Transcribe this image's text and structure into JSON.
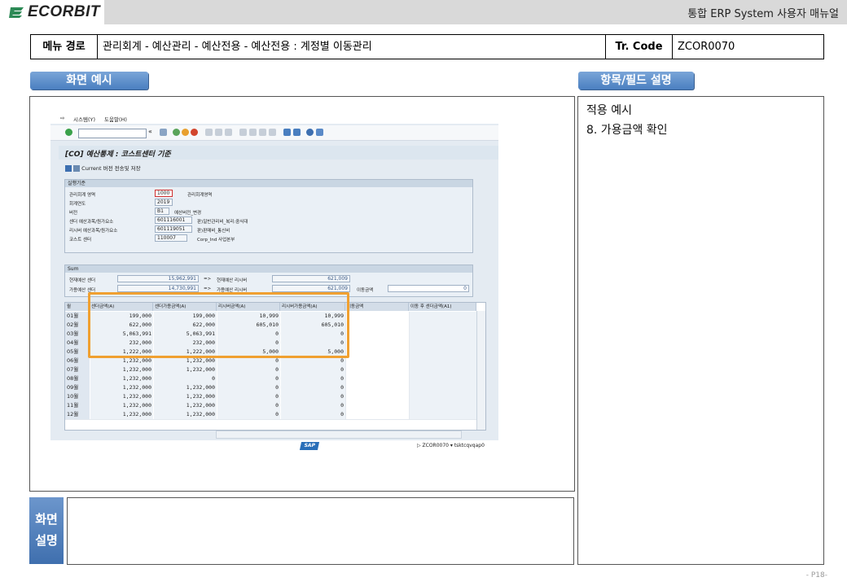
{
  "header": {
    "logo_text": "ECORBIT",
    "doc_title": "통합 ERP System 사용자 매뉴얼"
  },
  "menu_row": {
    "path_label": "메뉴 경로",
    "path_value": "관리회계 - 예산관리 - 예산전용 - 예산전용 : 계정별 이동관리",
    "tcode_label": "Tr. Code",
    "tcode_value": "ZCOR0070"
  },
  "sections": {
    "screen_example": "화면 예시",
    "field_desc": "항목/필드 설명"
  },
  "description": {
    "line1": "적용 예시",
    "line2": "8. 가용금액 확인"
  },
  "bottom": {
    "label_line1": "화면",
    "label_line2": "설명"
  },
  "page_number": "- P18-",
  "sap": {
    "menu": [
      "시스템(Y)",
      "도움말(H)"
    ],
    "title": "[CO] 예산통제 : 코스트센터 기준",
    "app_toolbar_label": "Current 버전 전송및 저장",
    "criteria": {
      "header": "실행기준",
      "rows": [
        {
          "label": "관리회계 영역",
          "value": "1000",
          "text": "관리회계영역"
        },
        {
          "label": "회계연도",
          "value": "2019",
          "text": ""
        },
        {
          "label": "버전",
          "value": "B1",
          "text": "예산버전_변경"
        },
        {
          "label": "센더 예산과목/원가요소",
          "value": "601116001",
          "text": "판)일반관리비_복리:중식대"
        },
        {
          "label": "리시버 예산과목/원가요소",
          "value": "601119051",
          "text": "판)판매비_통신비"
        },
        {
          "label": "코스트 센터",
          "value": "110007",
          "text": "Corp_Ind 사업본부"
        }
      ]
    },
    "sum": {
      "header": "Sum",
      "row1": {
        "label": "현재예산 센더",
        "value": "15,962,991",
        "arrow": "=>",
        "label2": "현재예산 리시버",
        "value2": "621,009"
      },
      "row2": {
        "label": "가용예산 센더",
        "value": "14,730,991",
        "arrow": "=>",
        "label2": "가용예산 리시버",
        "value2": "621,009",
        "label3": "이동금액",
        "value3": "0"
      }
    },
    "grid": {
      "columns": [
        "월",
        "센더금액(A)",
        "센더가용금액(A)",
        "리시버금액(A)",
        "리시버가용금액(A)",
        "이동금액",
        "이동 후 센더금액(A1)"
      ],
      "rows": [
        [
          "01월",
          "199,000",
          "199,000",
          "10,999",
          "10,999"
        ],
        [
          "02월",
          "622,000",
          "622,000",
          "605,010",
          "605,010"
        ],
        [
          "03월",
          "5,063,991",
          "5,063,991",
          "0",
          "0"
        ],
        [
          "04월",
          "232,000",
          "232,000",
          "0",
          "0"
        ],
        [
          "05월",
          "1,222,000",
          "1,222,000",
          "5,000",
          "5,000"
        ],
        [
          "06월",
          "1,232,000",
          "1,232,000",
          "0",
          "0"
        ],
        [
          "07월",
          "1,232,000",
          "1,232,000",
          "0",
          "0"
        ],
        [
          "08월",
          "1,232,000",
          "0",
          "0",
          "0"
        ],
        [
          "09월",
          "1,232,000",
          "1,232,000",
          "0",
          "0"
        ],
        [
          "10월",
          "1,232,000",
          "1,232,000",
          "0",
          "0"
        ],
        [
          "11월",
          "1,232,000",
          "1,232,000",
          "0",
          "0"
        ],
        [
          "12월",
          "1,232,000",
          "1,232,000",
          "0",
          "0"
        ]
      ]
    },
    "status": {
      "logo": "SAP",
      "tcode": "ZCOR0070",
      "server": "tsktcqvqap0"
    }
  }
}
